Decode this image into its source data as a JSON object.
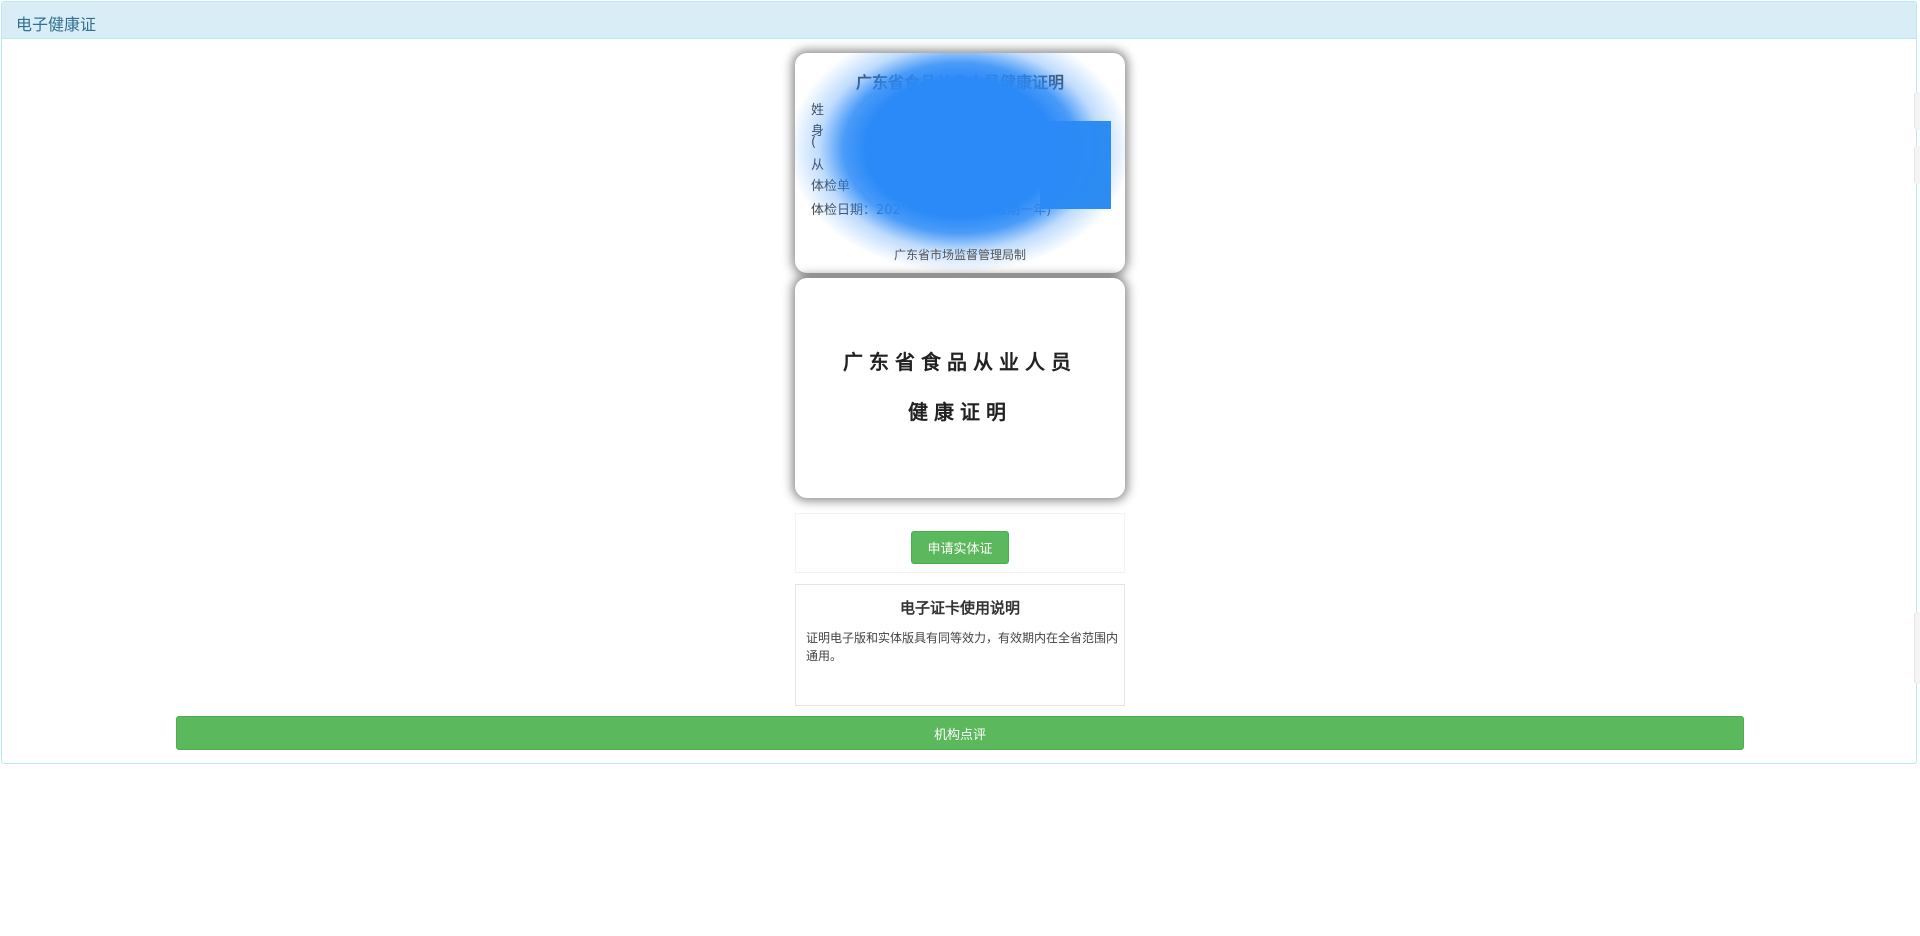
{
  "panel": {
    "heading": "电子健康证"
  },
  "card_front": {
    "title": "广东省食品从业人员健康证明",
    "fields": [
      {
        "label": "姓"
      },
      {
        "label": "身"
      },
      {
        "label": "("
      },
      {
        "label": "从"
      },
      {
        "label": "体检单"
      },
      {
        "label": "体检日期：202",
        "suffix": "效期一年)"
      }
    ],
    "issuer": "广东省市场监督管理局制"
  },
  "card_back": {
    "line1": "广东省食品从业人员",
    "line2": "健康证明"
  },
  "apply_button": "申请实体证",
  "info": {
    "title": "电子证卡使用说明",
    "text": "证明电子版和实体版具有同等效力，有效期内在全省范围内通用。"
  },
  "review_button": "机构点评",
  "colors": {
    "heading_bg": "#d9edf7",
    "heading_text": "#31708f",
    "button_green": "#5cb85c",
    "redaction_blue": "#2b8af7"
  }
}
